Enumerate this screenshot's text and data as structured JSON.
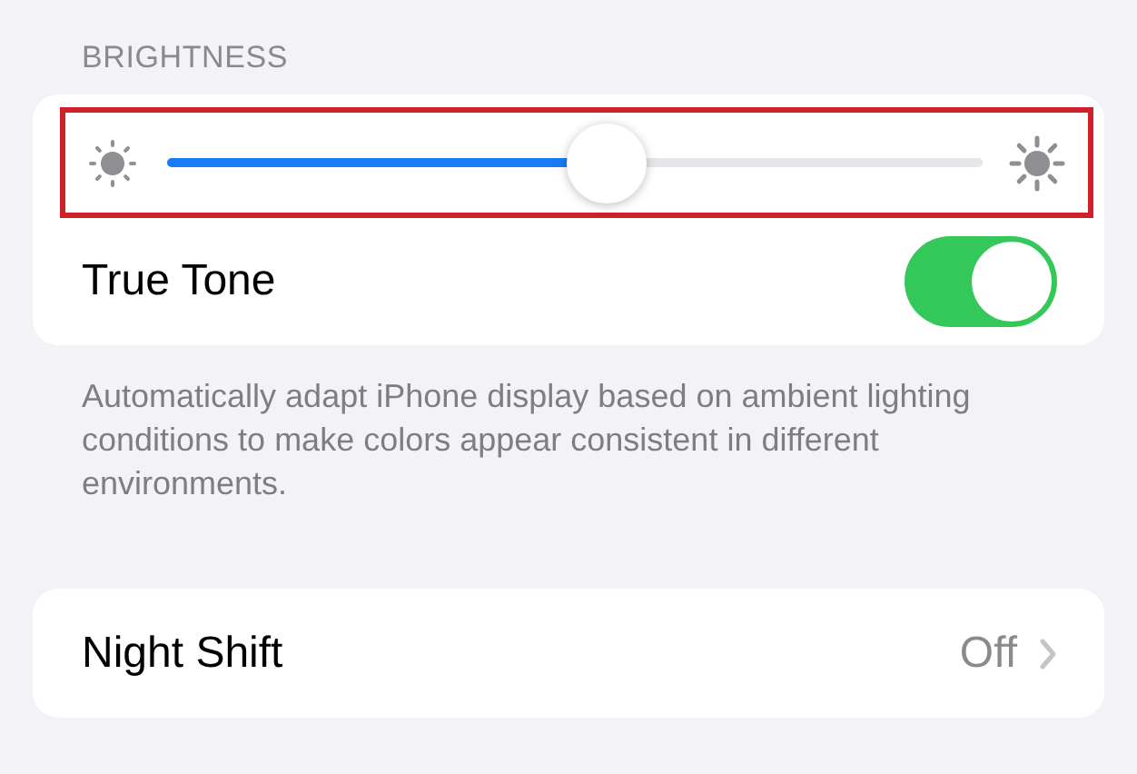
{
  "brightness": {
    "header": "BRIGHTNESS",
    "level": 0.54,
    "highlighted": true,
    "true_tone": {
      "label": "True Tone",
      "on": true
    }
  },
  "description": "Automatically adapt iPhone display based on ambient lighting conditions to make colors appear consistent in different environments.",
  "night_shift": {
    "label": "Night Shift",
    "value": "Off"
  }
}
